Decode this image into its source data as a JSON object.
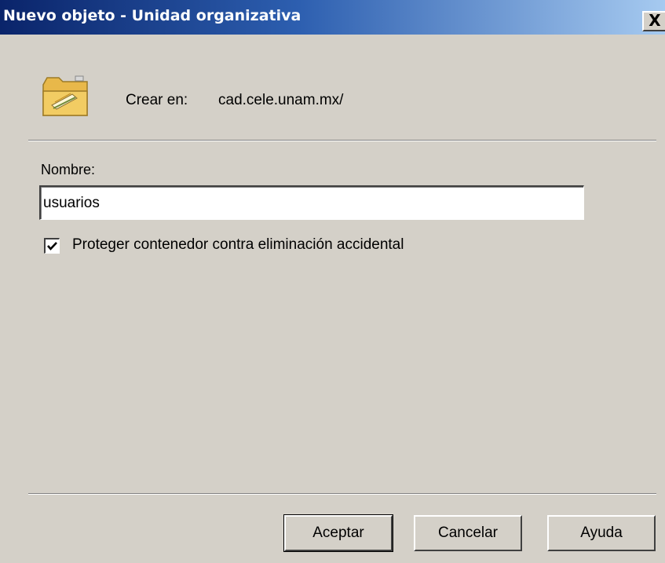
{
  "window": {
    "title": "Nuevo objeto - Unidad organizativa",
    "close_label": "X"
  },
  "header": {
    "icon": "folder-icon",
    "create_label": "Crear en:",
    "create_path": "cad.cele.unam.mx/"
  },
  "form": {
    "name_label": "Nombre:",
    "name_value": "usuarios",
    "protect_label": "Proteger contenedor contra eliminación accidental",
    "protect_checked": true
  },
  "buttons": {
    "ok_label": "Aceptar",
    "cancel_label": "Cancelar",
    "help_label": "Ayuda"
  },
  "colors": {
    "title_gradient_start": "#0a246a",
    "title_gradient_end": "#a6caf0",
    "dialog_face": "#d4d0c8",
    "folder_yellow": "#f2cc63"
  }
}
